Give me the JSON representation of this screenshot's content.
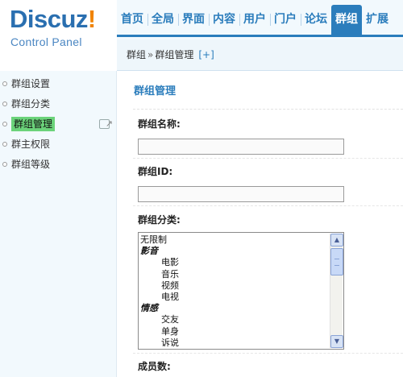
{
  "logo": {
    "name": "Discuz",
    "bang": "!",
    "subtitle": "Control Panel"
  },
  "topnav": {
    "tabs": [
      {
        "label": "首页"
      },
      {
        "label": "全局"
      },
      {
        "label": "界面"
      },
      {
        "label": "内容"
      },
      {
        "label": "用户"
      },
      {
        "label": "门户"
      },
      {
        "label": "论坛"
      },
      {
        "label": "群组",
        "active": true
      },
      {
        "label": "扩展"
      }
    ]
  },
  "breadcrumb": {
    "parent": "群组",
    "separator": "»",
    "current": "群组管理",
    "add": "[+]"
  },
  "sidebar": {
    "items": [
      {
        "label": "群组设置"
      },
      {
        "label": "群组分类"
      },
      {
        "label": "群组管理",
        "active": true
      },
      {
        "label": "群主权限"
      },
      {
        "label": "群组等级"
      }
    ]
  },
  "main": {
    "title": "群组管理",
    "fields": {
      "name_label": "群组名称:",
      "name_value": "",
      "id_label": "群组ID:",
      "id_value": "",
      "category_label": "群组分类:",
      "members_label": "成员数:"
    },
    "category_options": [
      {
        "label": "无限制",
        "type": "plain"
      },
      {
        "label": "影音",
        "type": "group"
      },
      {
        "label": "电影",
        "type": "indent"
      },
      {
        "label": "音乐",
        "type": "indent"
      },
      {
        "label": "视频",
        "type": "indent"
      },
      {
        "label": "电视",
        "type": "indent"
      },
      {
        "label": "情感",
        "type": "group"
      },
      {
        "label": "交友",
        "type": "indent"
      },
      {
        "label": "单身",
        "type": "indent"
      },
      {
        "label": "诉说",
        "type": "indent"
      }
    ]
  },
  "colors": {
    "accent": "#2b7dbc",
    "active_sidebar": "#6bd37a",
    "logo_orange": "#f08300"
  },
  "icons": {
    "sidebar_bullet": "circle-bullet-icon",
    "open_external": "external-link-icon"
  }
}
